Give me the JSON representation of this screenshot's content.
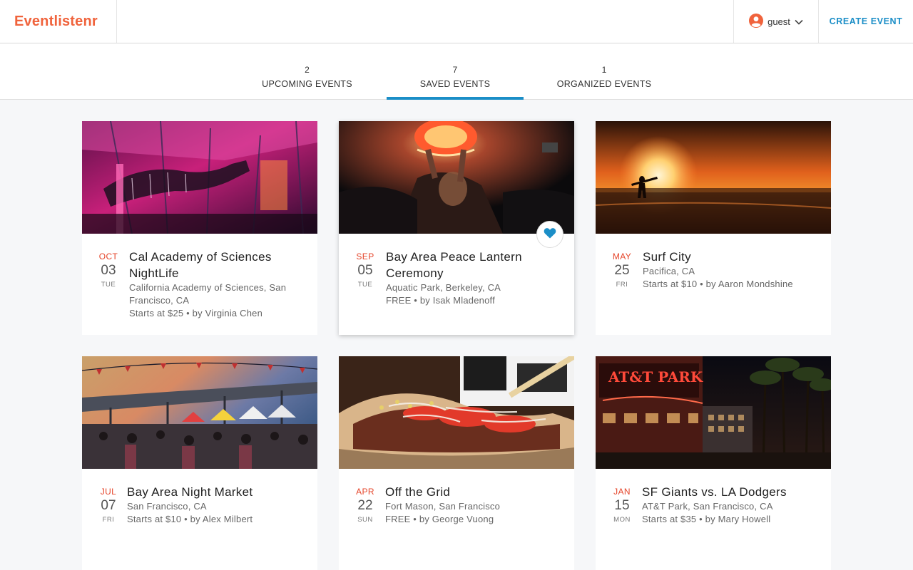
{
  "app": {
    "brand": "Eventlistenr"
  },
  "user": {
    "name": "guest"
  },
  "header": {
    "create_label": "CREATE EVENT"
  },
  "tabs": [
    {
      "count": "2",
      "label": "UPCOMING EVENTS",
      "active": false
    },
    {
      "count": "7",
      "label": "SAVED EVENTS",
      "active": true
    },
    {
      "count": "1",
      "label": "ORGANIZED EVENTS",
      "active": false
    }
  ],
  "colors": {
    "brand": "#f0633c",
    "accent": "#1b8ec7",
    "month": "#e5452a"
  },
  "events": [
    {
      "month": "OCT",
      "day": "03",
      "dow": "TUE",
      "title": "Cal Academy of Sciences NightLife",
      "location": "California Academy of Sciences, San Francisco, CA",
      "price_line": "Starts at $25 • by Virginia Chen",
      "image": "aquarium-night-photo",
      "saved": false
    },
    {
      "month": "SEP",
      "day": "05",
      "dow": "TUE",
      "title": "Bay Area Peace Lantern Ceremony",
      "location": "Aquatic Park, Berkeley, CA",
      "price_line": "FREE • by Isak Mladenoff",
      "image": "lantern-release-photo",
      "saved": true
    },
    {
      "month": "MAY",
      "day": "25",
      "dow": "FRI",
      "title": "Surf City",
      "location": "Pacifica, CA",
      "price_line": "Starts at $10 • by Aaron Mondshine",
      "image": "surfer-sunset-photo",
      "saved": false
    },
    {
      "month": "JUL",
      "day": "07",
      "dow": "FRI",
      "title": "Bay Area Night Market",
      "location": "San Francisco, CA",
      "price_line": "Starts at $10 • by Alex Milbert",
      "image": "night-market-photo",
      "saved": false
    },
    {
      "month": "APR",
      "day": "22",
      "dow": "SUN",
      "title": "Off the Grid",
      "location": "Fort Mason, San Francisco",
      "price_line": "FREE • by George Vuong",
      "image": "tacos-photo",
      "saved": false
    },
    {
      "month": "JAN",
      "day": "15",
      "dow": "MON",
      "title": "SF Giants vs. LA Dodgers",
      "location": "AT&T Park, San Francisco, CA",
      "price_line": "Starts at $35 • by Mary Howell",
      "image": "ballpark-night-photo",
      "saved": false
    }
  ]
}
